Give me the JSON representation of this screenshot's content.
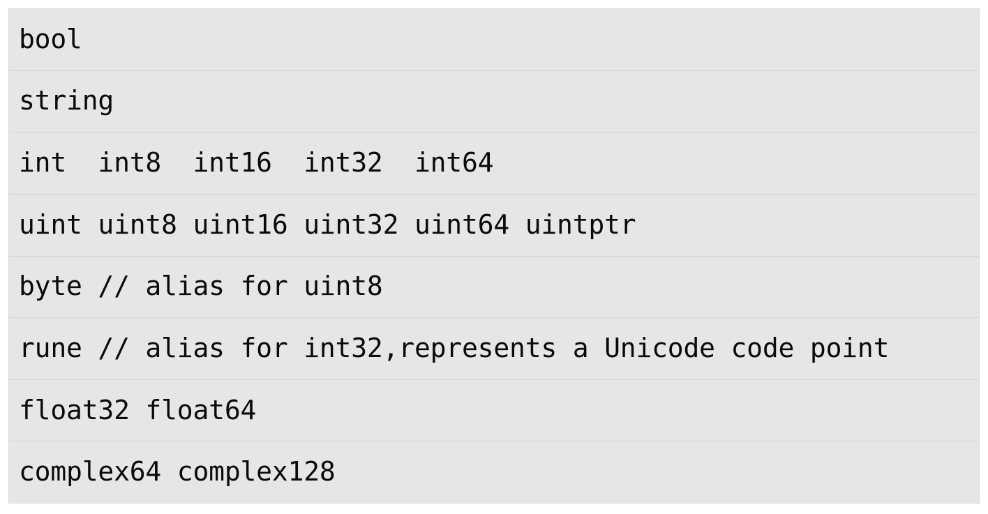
{
  "document": {
    "kind": "code-listing-table",
    "language": "go",
    "title": "Go basic types",
    "background_color": "#ffffff",
    "table_background_color": "#e6e6e6",
    "row_separator_color": "#d4d4d4",
    "text_color": "#0a0a0a"
  },
  "table": {
    "row_count": 8,
    "rows": [
      {
        "text": "bool"
      },
      {
        "text": "string"
      },
      {
        "text": "int  int8  int16  int32  int64"
      },
      {
        "text": "uint uint8 uint16 uint32 uint64 uintptr"
      },
      {
        "text": "byte // alias for uint8"
      },
      {
        "text": "rune // alias for int32,represents a Unicode code point"
      },
      {
        "text": "float32 float64"
      },
      {
        "text": "complex64 complex128"
      }
    ]
  }
}
